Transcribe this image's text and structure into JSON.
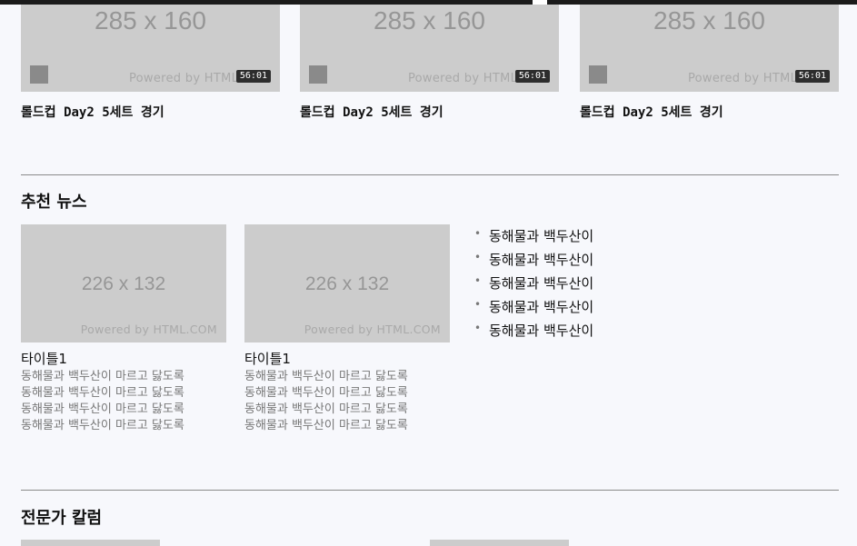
{
  "videos": [
    {
      "thumb_size": "285 x 160",
      "powered": "Powered by HTML.COM",
      "duration": "56:01",
      "title": "롤드컵 Day2 5세트 경기"
    },
    {
      "thumb_size": "285 x 160",
      "powered": "Powered by HTML.COM",
      "duration": "56:01",
      "title": "롤드컵 Day2 5세트 경기"
    },
    {
      "thumb_size": "285 x 160",
      "powered": "Powered by HTML.COM",
      "duration": "56:01",
      "title": "롤드컵 Day2 5세트 경기"
    }
  ],
  "recommended": {
    "heading": "추천 뉴스",
    "cards": [
      {
        "thumb_size": "226 x 132",
        "powered": "Powered by HTML.COM",
        "title": "타이틀1",
        "desc": "동해물과 백두산이 마르고 닳도록\n동해물과 백두산이 마르고 닳도록\n동해물과 백두산이 마르고 닳도록\n동해물과 백두산이 마르고 닳도록"
      },
      {
        "thumb_size": "226 x 132",
        "powered": "Powered by HTML.COM",
        "title": "타이틀1",
        "desc": "동해물과 백두산이 마르고 닳도록\n동해물과 백두산이 마르고 닳도록\n동해물과 백두산이 마르고 닳도록\n동해물과 백두산이 마르고 닳도록"
      }
    ],
    "list": [
      "동해물과 백두산이",
      "동해물과 백두산이",
      "동해물과 백두산이",
      "동해물과 백두산이",
      "동해물과 백두산이"
    ]
  },
  "columns": {
    "heading": "전문가 칼럼"
  },
  "colors": {
    "background": "#f7f8fc",
    "placeholder": "#cccccc",
    "divider": "#8a8a8a",
    "topbar": "#1b1b1b"
  }
}
